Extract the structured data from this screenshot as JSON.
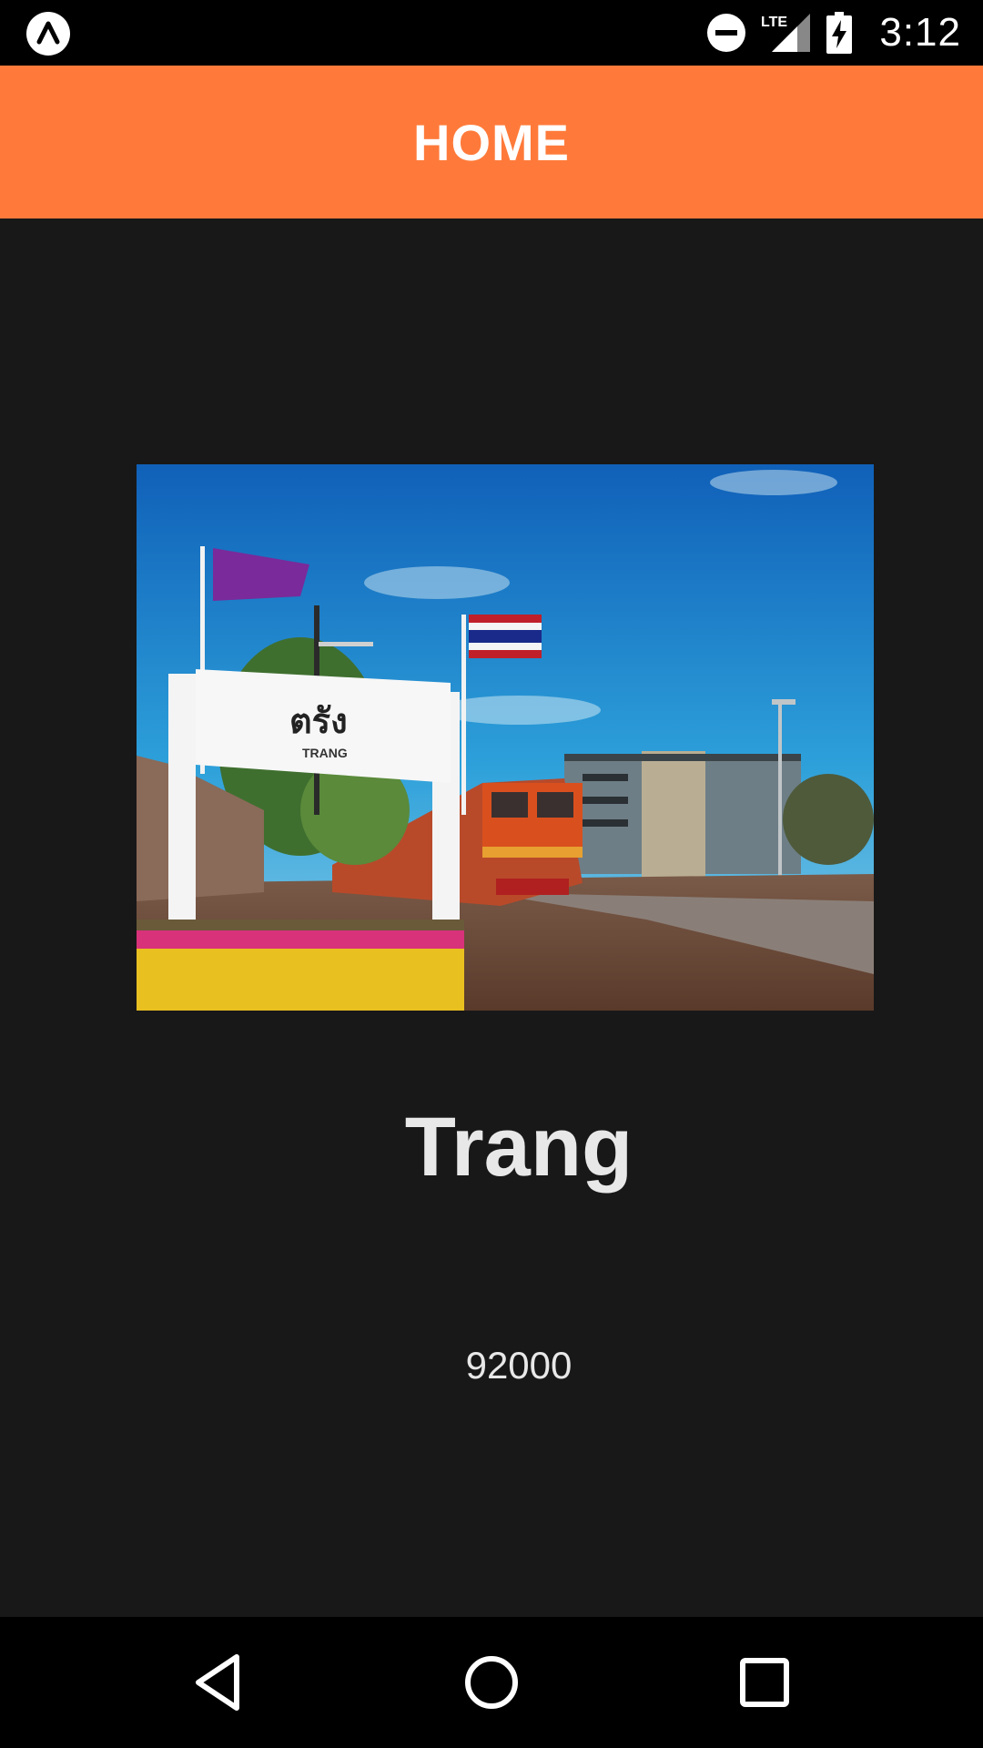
{
  "status_bar": {
    "time": "3:12",
    "network_label": "LTE",
    "icons": [
      "app-logo-icon",
      "do-not-disturb-icon",
      "lte-signal-icon",
      "battery-charging-icon"
    ]
  },
  "app_bar": {
    "title": "HOME",
    "color": "#FF7A3A"
  },
  "place": {
    "name": "Trang",
    "postal_code": "92000",
    "image": {
      "description_icon": "trang-station-photo",
      "sign_thai_text": "ตรัง",
      "sign_latin_text": "TRANG"
    }
  },
  "nav_bar": {
    "icons": [
      "back-icon",
      "home-icon",
      "recents-icon"
    ]
  }
}
